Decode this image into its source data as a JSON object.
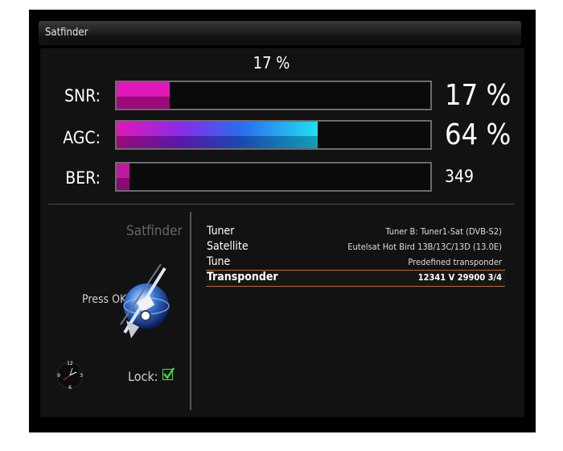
{
  "window": {
    "title": "Satfinder"
  },
  "header": {
    "percent": "17 %"
  },
  "meters": [
    {
      "label": "SNR:",
      "value": "17 %",
      "level": 0.17
    },
    {
      "label": "AGC:",
      "value": "64 %",
      "level": 0.64
    },
    {
      "label": "BER:",
      "value": "349",
      "level": 0.04
    }
  ],
  "left": {
    "title": "Satfinder",
    "press": "Press OK",
    "lock_label": "Lock:",
    "clock": {
      "n12": "12",
      "n3": "3",
      "n6": "6",
      "n9": "9"
    }
  },
  "info": [
    {
      "key": "Tuner",
      "value": "Tuner B: Tuner1-Sat (DVB-S2)"
    },
    {
      "key": "Satellite",
      "value": "Eutelsat Hot Bird 13B/13C/13D (13.0E)"
    },
    {
      "key": "Tune",
      "value": "Predefined transponder"
    },
    {
      "key": "Transponder",
      "value": "12341 V 29900 3/4"
    }
  ],
  "colors": {
    "magenta": "#e020b8",
    "cyan": "#20e0f0",
    "lock_green": "#3ddc3d",
    "selection": "#c46a1a"
  }
}
